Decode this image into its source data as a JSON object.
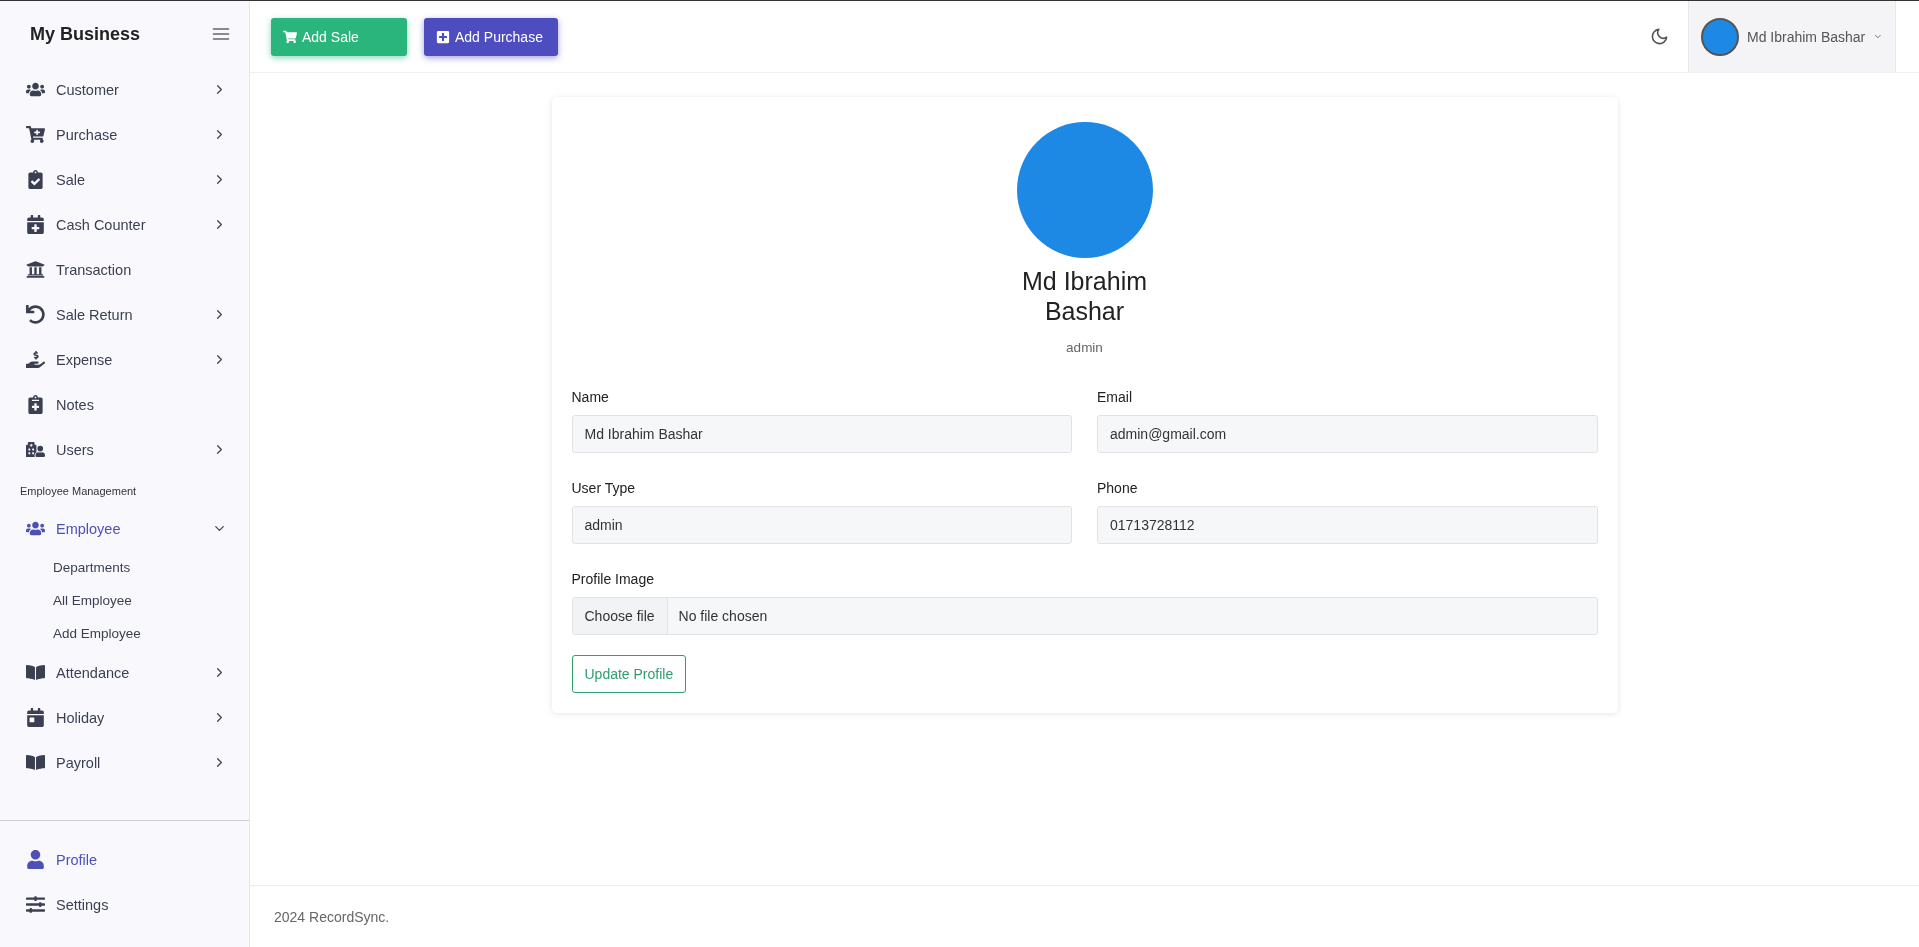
{
  "sidebar": {
    "brand": "My Business",
    "items": [
      {
        "label": "Customer",
        "kind": "group",
        "expanded": false,
        "selected": false
      },
      {
        "label": "Purchase",
        "kind": "group",
        "expanded": false,
        "selected": false
      },
      {
        "label": "Sale",
        "kind": "group",
        "expanded": false,
        "selected": false
      },
      {
        "label": "Cash Counter",
        "kind": "group",
        "expanded": false,
        "selected": false
      },
      {
        "label": "Transaction",
        "kind": "link",
        "expanded": false,
        "selected": false
      },
      {
        "label": "Sale Return",
        "kind": "group",
        "expanded": false,
        "selected": false
      },
      {
        "label": "Expense",
        "kind": "group",
        "expanded": false,
        "selected": false
      },
      {
        "label": "Notes",
        "kind": "link",
        "expanded": false,
        "selected": false
      },
      {
        "label": "Users",
        "kind": "group",
        "expanded": false,
        "selected": false
      }
    ],
    "section_heading": "Employee Management",
    "employee_items": [
      {
        "label": "Employee",
        "kind": "group",
        "expanded": true,
        "selected": true,
        "children": [
          {
            "label": "Departments"
          },
          {
            "label": "All Employee"
          },
          {
            "label": "Add Employee"
          }
        ]
      },
      {
        "label": "Attendance",
        "kind": "group",
        "expanded": false,
        "selected": false
      },
      {
        "label": "Holiday",
        "kind": "group",
        "expanded": false,
        "selected": false
      },
      {
        "label": "Payroll",
        "kind": "group",
        "expanded": false,
        "selected": false
      }
    ],
    "bottom_items": [
      {
        "label": "Profile",
        "selected": true
      },
      {
        "label": "Settings",
        "selected": false
      }
    ]
  },
  "topbar": {
    "buttons": [
      {
        "label": "Add Sale",
        "kind": "sale"
      },
      {
        "label": "Add Purchase",
        "kind": "purchase"
      }
    ],
    "user_name": "Md Ibrahim Bashar"
  },
  "profile": {
    "name": "Md Ibrahim Bashar",
    "role": "admin",
    "fields": [
      {
        "label": "Name",
        "value": "Md Ibrahim Bashar"
      },
      {
        "label": "Email",
        "value": "admin@gmail.com"
      },
      {
        "label": "User Type",
        "value": "admin"
      },
      {
        "label": "Phone",
        "value": "01713728112"
      }
    ],
    "image_field": {
      "label": "Profile Image",
      "button": "Choose file",
      "status": "No file chosen"
    },
    "submit": "Update Profile"
  },
  "footer": "2024 RecordSync."
}
